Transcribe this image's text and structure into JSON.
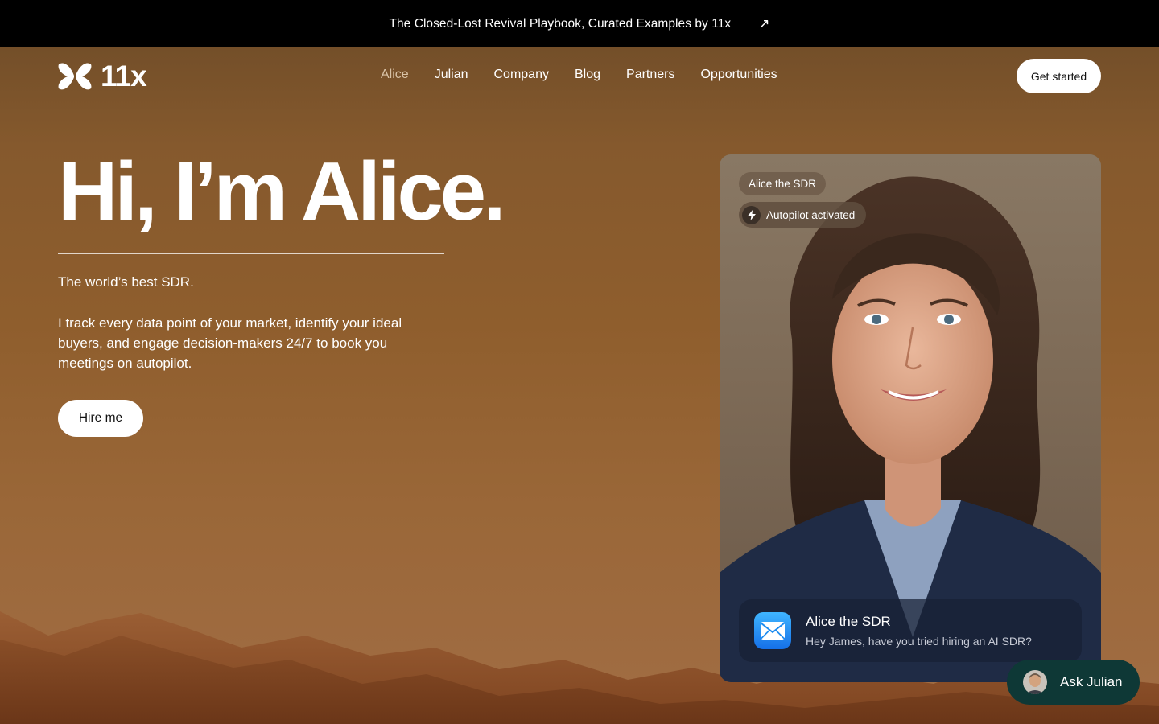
{
  "announcement": {
    "text": "The Closed-Lost Revival Playbook, Curated Examples by 11x",
    "arrow": "↗"
  },
  "header": {
    "logo_text": "11x",
    "nav": [
      {
        "label": "Alice",
        "active": true
      },
      {
        "label": "Julian",
        "active": false
      },
      {
        "label": "Company",
        "active": false
      },
      {
        "label": "Blog",
        "active": false
      },
      {
        "label": "Partners",
        "active": false
      },
      {
        "label": "Opportunities",
        "active": false
      }
    ],
    "cta_label": "Get started"
  },
  "hero": {
    "title": "Hi, I’m Alice.",
    "tagline": "The world’s best SDR.",
    "description": "I track every data point of your market, identify your ideal buyers, and engage decision-makers 24/7 to book you meetings on autopilot.",
    "button_label": "Hire me"
  },
  "card": {
    "name_chip": "Alice the SDR",
    "status_chip": "Autopilot activated",
    "notification": {
      "title": "Alice the SDR",
      "body": "Hey James, have you tried hiring an AI SDR?",
      "icon": "mail-icon"
    }
  },
  "chat_widget": {
    "label": "Ask Julian"
  },
  "colors": {
    "announcement_bg": "#000000",
    "background_brown": "#8f5e2d",
    "nav_active": "#d8c2a6",
    "chat_widget_bg": "#0e3836",
    "mail_icon_blue": "#1570e8"
  }
}
